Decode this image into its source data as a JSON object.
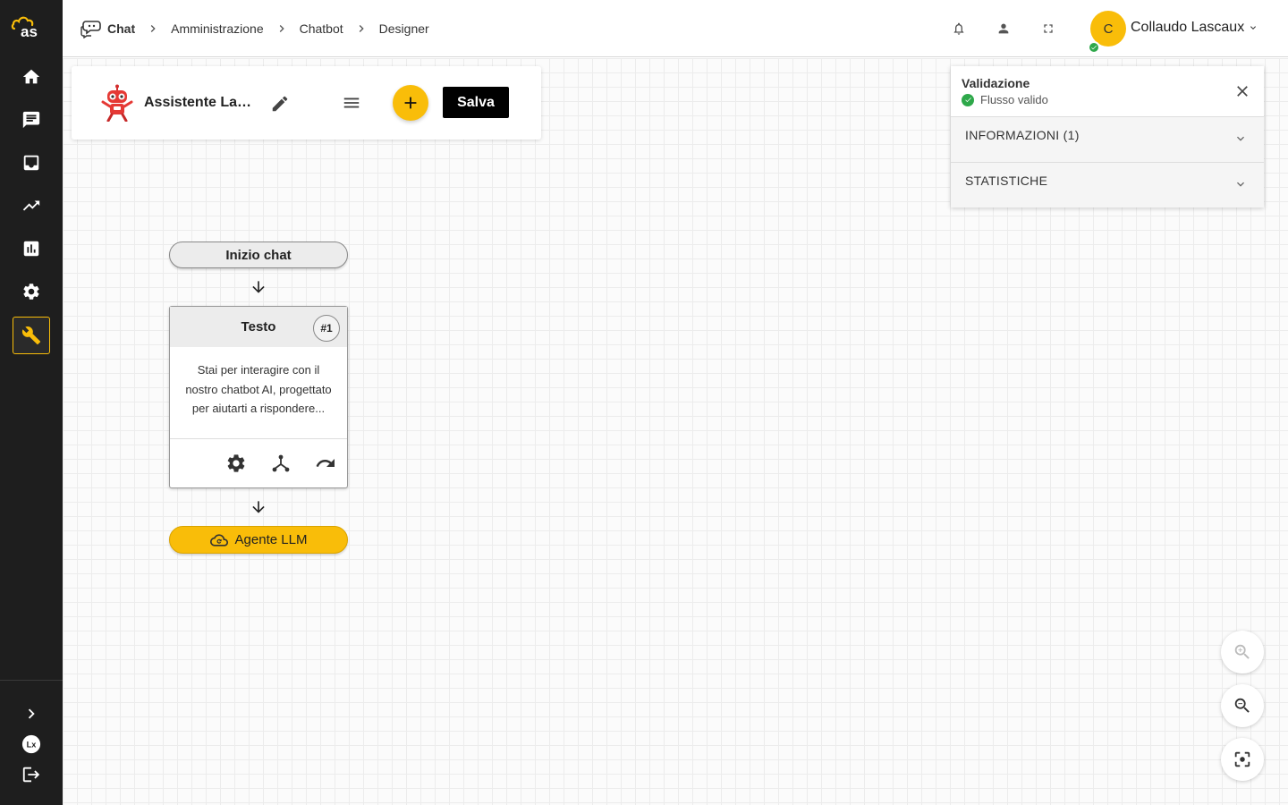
{
  "colors": {
    "accent": "#f9bd09",
    "sidebar": "#1e1e1e",
    "success": "#2ea84a"
  },
  "sidebar": {
    "logo": "as",
    "items": [
      {
        "icon": "home-icon"
      },
      {
        "icon": "chat-icon"
      },
      {
        "icon": "inbox-icon"
      },
      {
        "icon": "trending-icon"
      },
      {
        "icon": "bar-chart-icon"
      },
      {
        "icon": "gear-icon"
      },
      {
        "icon": "wrench-icon",
        "active": true
      }
    ],
    "bottom": [
      "chevron-right-icon",
      "lx-icon",
      "logout-icon"
    ]
  },
  "header": {
    "breadcrumbs": [
      "Chat",
      "Amministrazione",
      "Chatbot",
      "Designer"
    ],
    "icons": [
      "bell-icon",
      "person-icon",
      "fullscreen-icon"
    ],
    "avatar_initial": "C",
    "user_name": "Collaudo Lascaux"
  },
  "toolbar": {
    "bot_name": "Assistente La…",
    "save_label": "Salva"
  },
  "validation": {
    "title": "Validazione",
    "status": "Flusso valido",
    "sections": [
      "INFORMAZIONI (1)",
      "STATISTICHE"
    ]
  },
  "flow": {
    "start_label": "Inizio chat",
    "text_node": {
      "title": "Testo",
      "badge": "#1",
      "body": "Stai per interagire con il nostro chatbot AI, progettato per aiutarti a rispondere..."
    },
    "agent_label": "Agente LLM"
  },
  "zoom": [
    "zoom-in-icon",
    "zoom-out-icon",
    "center-focus-icon"
  ]
}
